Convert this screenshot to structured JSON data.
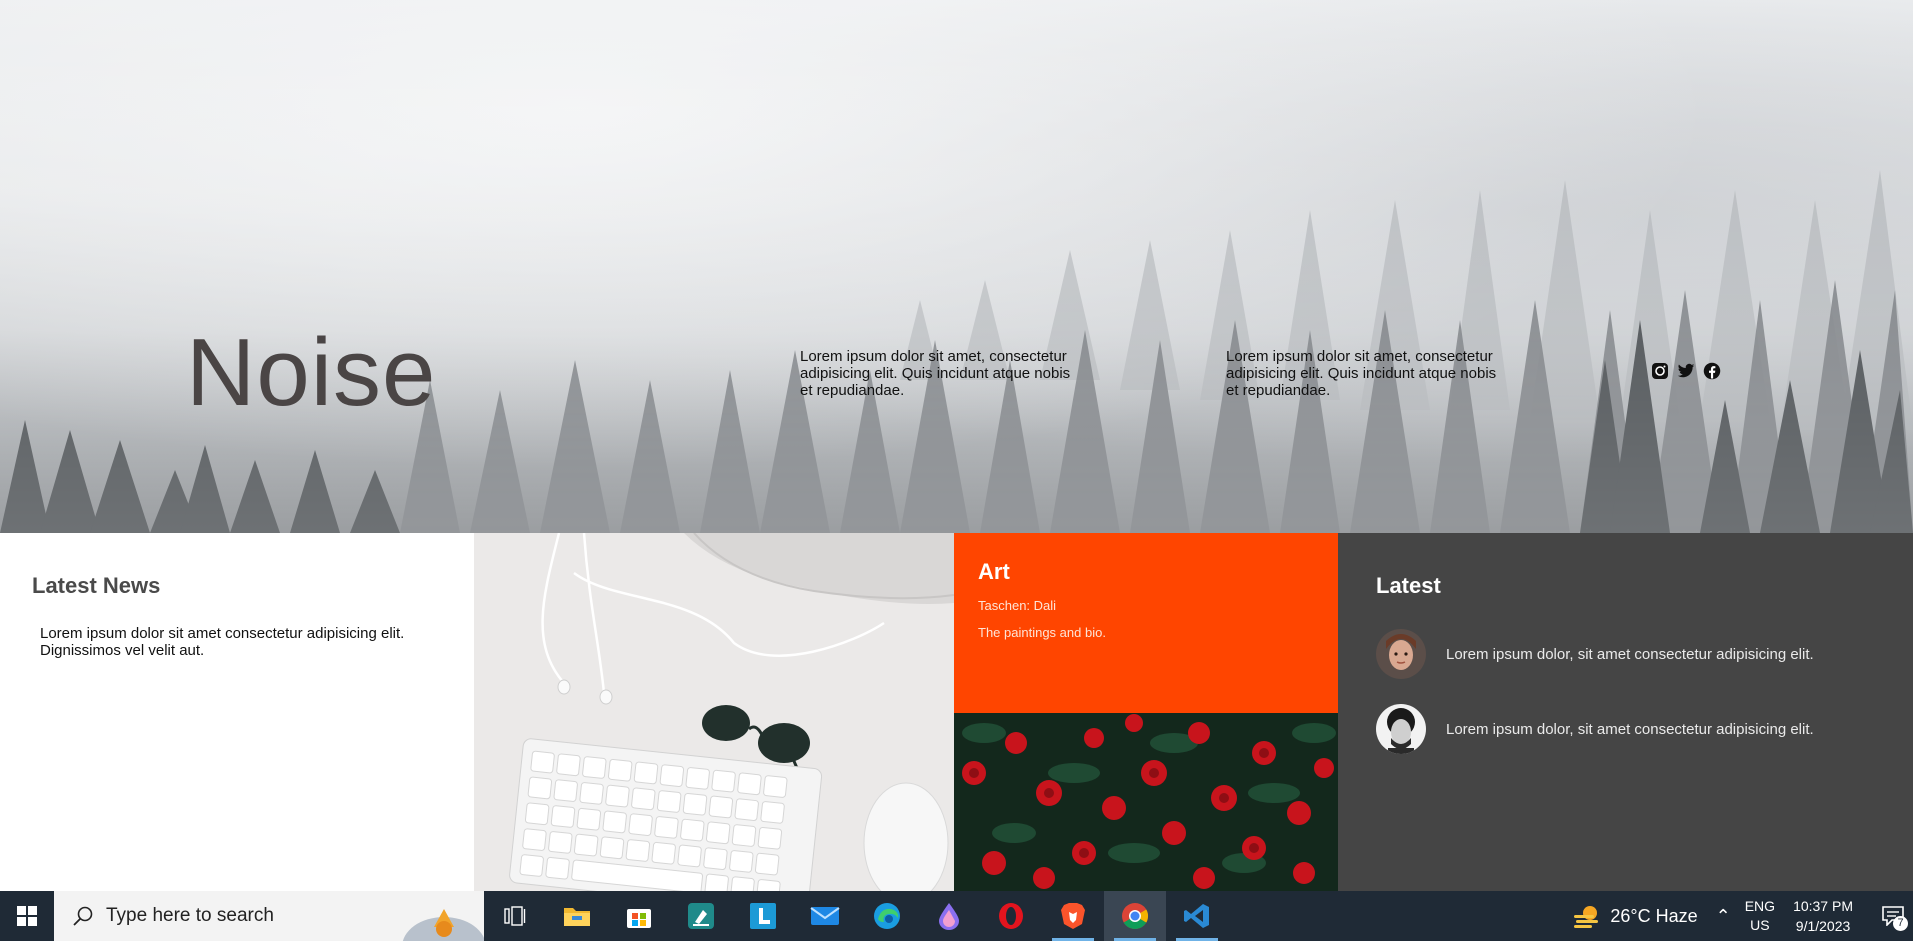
{
  "hero": {
    "title": "Noise",
    "text_1": "Lorem ipsum dolor sit amet, consectetur adipisicing elit. Quis incidunt atque nobis et repudiandae.",
    "text_2": "Lorem ipsum dolor sit amet, consectetur adipisicing elit. Quis incidunt atque nobis et repudiandae.",
    "social_icons": [
      "instagram-icon",
      "twitter-icon",
      "facebook-icon"
    ]
  },
  "news": {
    "heading": "Latest News",
    "body": "Lorem ipsum dolor sit amet consectetur adipisicing elit. Dignissimos vel velit aut."
  },
  "art": {
    "heading": "Art",
    "meta": "Taschen:  Dali",
    "description": "The paintings and bio."
  },
  "latest": {
    "heading": "Latest",
    "items": [
      {
        "text": "Lorem ipsum dolor, sit amet consectetur adipisicing elit."
      },
      {
        "text": "Lorem ipsum dolor, sit amet consectetur adipisicing elit."
      }
    ]
  },
  "taskbar": {
    "search_placeholder": "Type here to search",
    "apps": [
      "task-view-icon",
      "file-explorer-icon",
      "store-icon",
      "app-icon",
      "l-app-icon",
      "mail-icon",
      "edge-icon",
      "paint-icon",
      "opera-icon",
      "brave-icon",
      "chrome-icon",
      "vscode-icon"
    ],
    "weather": "26°C  Haze",
    "lang_line1": "ENG",
    "lang_line2": "US",
    "time": "10:37 PM",
    "date": "9/1/2023",
    "notification_count": "7"
  },
  "colors": {
    "accent_orange": "#ff4500",
    "dark_panel": "#454545",
    "taskbar": "#1f2a36"
  }
}
